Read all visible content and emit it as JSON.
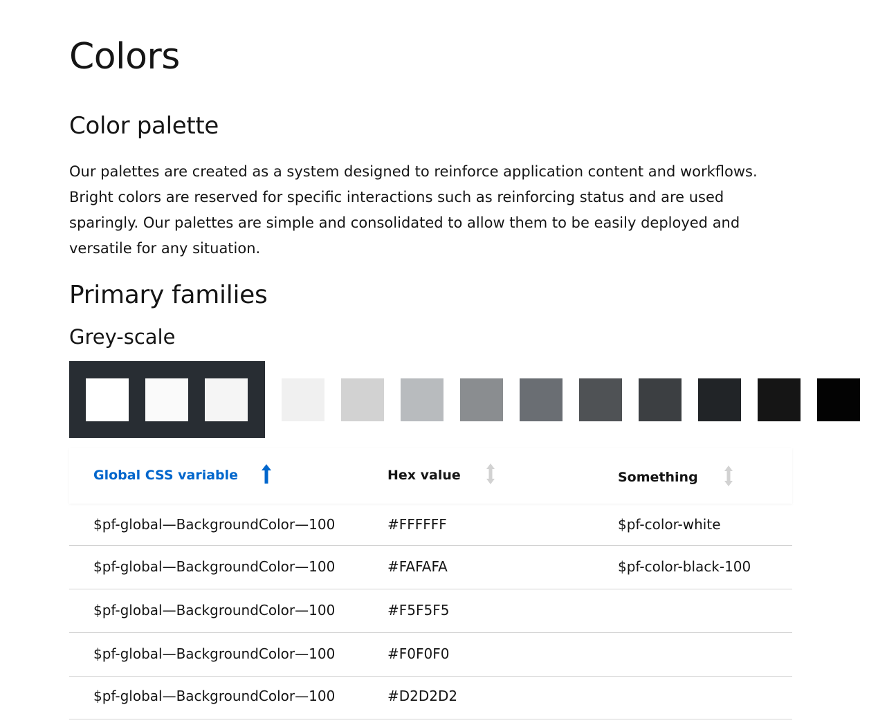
{
  "page": {
    "title": "Colors",
    "section_title": "Color palette",
    "intro": "Our palettes are created as a system designed to reinforce application content and workflows. Bright colors are reserved for specific interactions such as reinforcing status and are used sparingly. Our palettes are simple and consolidated to allow them to be easily deployed and versatile for any situation.",
    "families_title": "Primary families",
    "greyscale_title": "Grey-scale"
  },
  "swatches": {
    "group_background": "#282d33",
    "selected": [
      "#FFFFFF",
      "#FAFAFA",
      "#F5F5F5"
    ],
    "others": [
      "#F0F0F0",
      "#D2D2D2",
      "#B8BBBE",
      "#8A8D90",
      "#6A6E73",
      "#4F5255",
      "#3C3F42",
      "#212427",
      "#151515",
      "#030303"
    ]
  },
  "table": {
    "headers": {
      "col1": "Global CSS variable",
      "col2": "Hex value",
      "col3": "Something"
    },
    "sort": {
      "active_color": "#0066cc",
      "inactive_color": "#d2d2d2"
    },
    "rows": [
      {
        "variable": "$pf-global—BackgroundColor—100",
        "hex": "#FFFFFF",
        "something": "$pf-color-white"
      },
      {
        "variable": "$pf-global—BackgroundColor—100",
        "hex": "#FAFAFA",
        "something": "$pf-color-black-100"
      },
      {
        "variable": "$pf-global—BackgroundColor—100",
        "hex": "#F5F5F5",
        "something": ""
      },
      {
        "variable": "$pf-global—BackgroundColor—100",
        "hex": "#F0F0F0",
        "something": ""
      },
      {
        "variable": "$pf-global—BackgroundColor—100",
        "hex": "#D2D2D2",
        "something": ""
      }
    ]
  }
}
